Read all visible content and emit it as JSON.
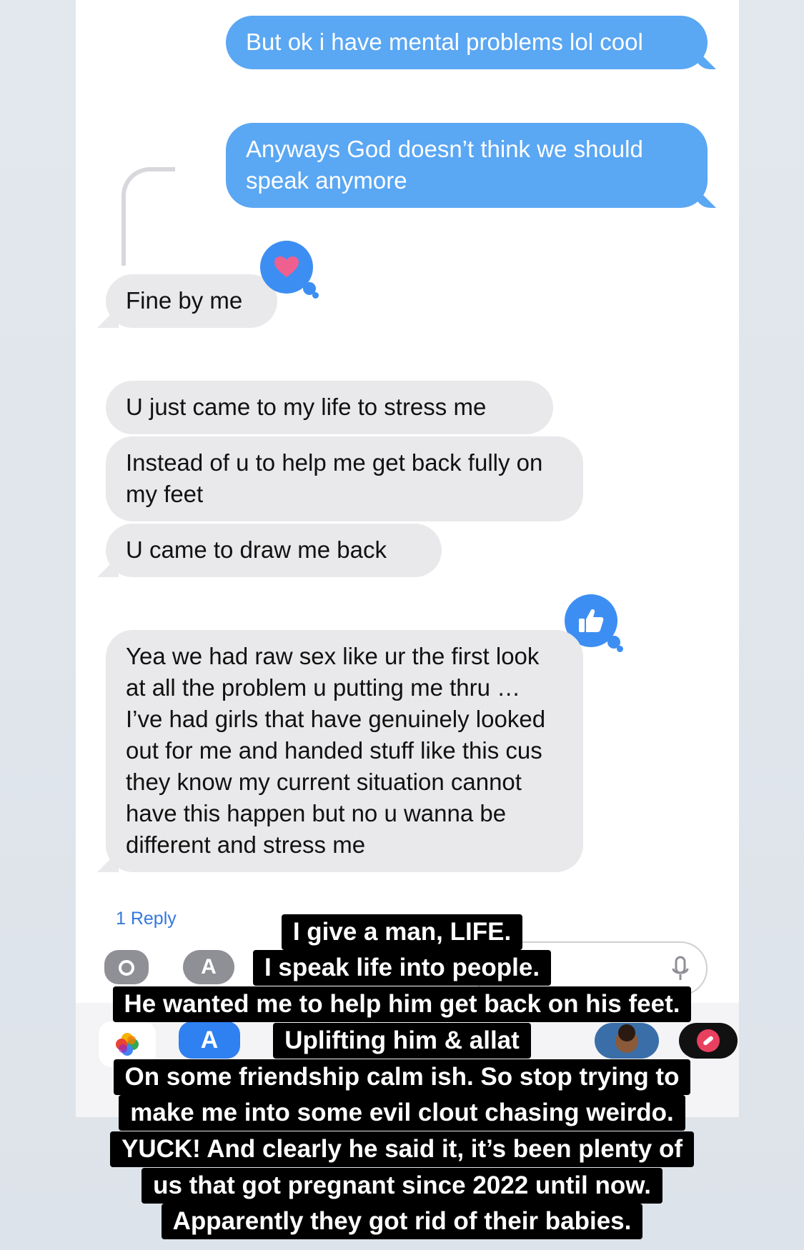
{
  "messages": {
    "m1": "But ok i have mental problems lol cool",
    "m2": "Anyways God doesn’t think we should speak anymore",
    "m3": "Fine by me",
    "m4": "U just came to my life to stress me",
    "m5": "Instead of u to help me get back fully on my feet",
    "m6": "U came to draw me back",
    "m7": "Yea we had raw sex like ur the first look at all the problem u putting me thru … I’ve had girls that have genuinely looked out for me and handed stuff like this cus they know my current situation cannot have this happen but no u wanna be different and stress me"
  },
  "thread": {
    "reply_count": "1 Reply"
  },
  "tapbacks": {
    "heart_icon": "heart-icon",
    "thumbs_up_icon": "thumbs-up-icon"
  },
  "toolbar": {
    "camera_icon": "camera-icon",
    "apps_icon": "app-store-icon",
    "mic_icon": "microphone-icon"
  },
  "colors": {
    "outgoing": "#5aa7f3",
    "incoming": "#e9e9eb",
    "tapback": "#3d8ef2",
    "caption_bg": "#000000"
  },
  "captions": [
    "I give a man, LIFE.",
    "I speak life into people.",
    "He wanted me to help him get back on his feet.",
    "Uplifting him & allat",
    "On some friendship calm ish. So stop trying to",
    "make me into some evil clout chasing weirdo.",
    "YUCK! And clearly he said it, it’s been plenty of",
    "us that got pregnant since 2022 until now.",
    "Apparently they got rid of their babies."
  ]
}
